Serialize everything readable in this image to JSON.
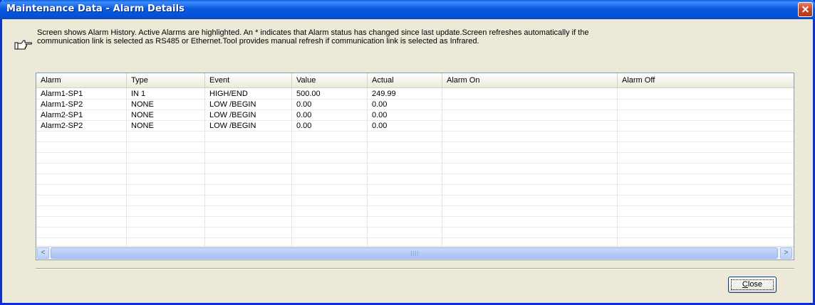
{
  "window": {
    "title": "Maintenance Data - Alarm Details"
  },
  "info": {
    "icon": "pointing-hand-icon",
    "text": "Screen shows Alarm History.  Active Alarms are highlighted. An * indicates that Alarm status has changed since last update.Screen refreshes automatically if the communication link is selected as RS485 or Ethernet.Tool provides manual refresh if communication link is selected as Infrared."
  },
  "table": {
    "columns": [
      "Alarm",
      "Type",
      "Event",
      "Value",
      "Actual",
      "Alarm On",
      "Alarm Off"
    ],
    "rows": [
      [
        "Alarm1-SP1",
        "IN 1",
        "HIGH/END",
        "500.00",
        "249.99",
        "",
        ""
      ],
      [
        "Alarm1-SP2",
        "NONE",
        "LOW /BEGIN",
        "0.00",
        "0.00",
        "",
        ""
      ],
      [
        "Alarm2-SP1",
        "NONE",
        "LOW /BEGIN",
        "0.00",
        "0.00",
        "",
        ""
      ],
      [
        "Alarm2-SP2",
        "NONE",
        "LOW /BEGIN",
        "0.00",
        "0.00",
        "",
        ""
      ]
    ]
  },
  "scrollbar": {
    "left_arrow": "<",
    "right_arrow": ">"
  },
  "buttons": {
    "close_label_mnemonic": "C",
    "close_label_rest": "lose"
  },
  "colors": {
    "titlebar": "#0A5AE0",
    "window_bg": "#ECE9D8",
    "close_x": "#C94225"
  }
}
